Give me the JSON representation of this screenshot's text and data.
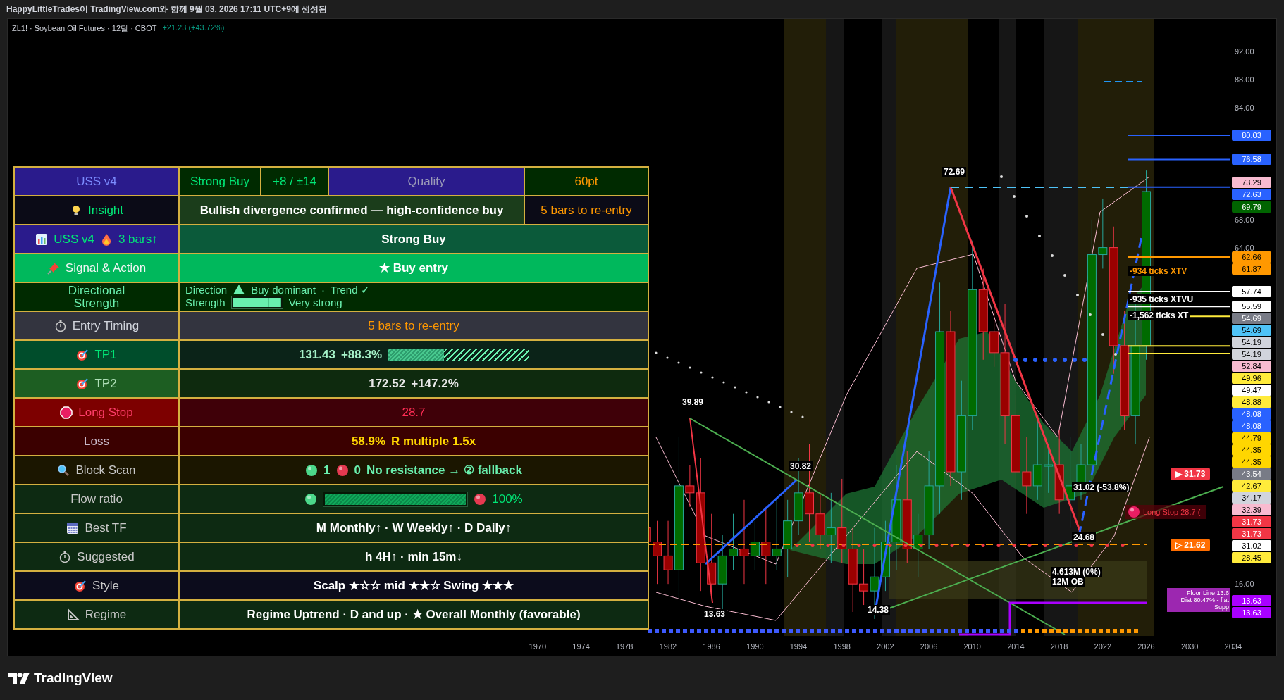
{
  "header": {
    "text": "HappyLittleTrades이 TradingView.com와 함께 9월 03, 2026 17:11 UTC+9에 생성됨"
  },
  "legend": {
    "symbol": "ZL1! · Soybean Oil Futures · 12달 · CBOT",
    "change": "+21.23 (+43.72%)"
  },
  "table": {
    "header": [
      "USS v4",
      "Strong Buy",
      "+8 / ±14",
      "Quality",
      "60pt"
    ],
    "rows": [
      {
        "kind": "insight",
        "label": "Insight",
        "message": "Bullish divergence confirmed — high-confidence buy",
        "note": "5 bars to re-entry"
      },
      {
        "kind": "streak",
        "label": "USS v4",
        "streak": "3 bars↑",
        "value": "Strong Buy"
      },
      {
        "kind": "plain",
        "label": "Signal & Action",
        "value": "★ Buy entry"
      },
      {
        "kind": "direction",
        "label": "Directional Strength",
        "direction_label": "Direction",
        "direction": "Buy dominant",
        "separator": "·",
        "trend": "Trend ✓",
        "strength_label": "Strength",
        "level": 1,
        "strength": "Very strong"
      },
      {
        "kind": "plain",
        "label": "Entry Timing",
        "value": "5 bars to re-entry"
      },
      {
        "kind": "target",
        "label": "TP1",
        "price": "131.43",
        "change": "+88.3%",
        "level": 0.4
      },
      {
        "kind": "target",
        "label": "TP2",
        "price": "172.52",
        "change": "+147.2%"
      },
      {
        "kind": "plain",
        "label": "Long Stop",
        "value": "28.7"
      },
      {
        "kind": "pair",
        "label": "Loss",
        "value": "58.9%",
        "extra": "R multiple 1.5x"
      },
      {
        "kind": "scan",
        "label": "Block Scan",
        "support": "1",
        "resistance": "0",
        "note": "No resistance → ② fallback"
      },
      {
        "kind": "flow",
        "label": "Flow ratio",
        "level": 1,
        "value": "100%"
      },
      {
        "kind": "plain",
        "label": "Best TF",
        "value": "M Monthly↑ · W Weekly↑ · D Daily↑"
      },
      {
        "kind": "plain",
        "label": "Suggested",
        "value": "h 4H↑ · min 15m↓"
      },
      {
        "kind": "plain",
        "label": "Style",
        "value": "Scalp ★☆☆ mid ★★☆ Swing ★★★"
      },
      {
        "kind": "plain",
        "label": "Regime",
        "value": "Regime Uptrend · D and up · ★ Overall Monthly (favorable)"
      }
    ]
  },
  "annotations": [
    {
      "text": "72.69"
    },
    {
      "text": "39.89"
    },
    {
      "text": "30.82"
    },
    {
      "text": "13.63"
    },
    {
      "text": "14.38"
    },
    {
      "text": "24.68"
    },
    {
      "text": "-935 ticks XTVU"
    },
    {
      "text": "-1,562 ticks XT"
    },
    {
      "text": "31.02 (-53.8%)"
    },
    {
      "text": "4.613M (0%)"
    },
    {
      "text": "12M OB"
    }
  ],
  "target_note": {
    "text": "-934 ticks XTV"
  },
  "callouts": [
    {
      "text": "▶ 31.73",
      "color": "#f23645"
    },
    {
      "text": "▷ 21.62",
      "color": "#ff6d00"
    }
  ],
  "long_stop": {
    "text": "Long Stop 28.7 (-"
  },
  "floor_label": [
    "Floor Line 13.6",
    "Dist 80.47% - flat",
    "Supp"
  ],
  "price_axis": {
    "ticks": [
      "92.00",
      "88.00",
      "84.00",
      "68.00",
      "64.00",
      "16.00"
    ],
    "tags": [
      {
        "text": "80.03",
        "color": "#2962ff"
      },
      {
        "text": "76.58",
        "color": "#2962ff"
      },
      {
        "text": "73.29",
        "color": "#f8bbd0"
      },
      {
        "text": "72.63",
        "color": "#2962ff"
      },
      {
        "text": "69.79",
        "color": "#006400"
      },
      {
        "text": "62.66",
        "color": "#ff9800"
      },
      {
        "text": "61.87",
        "color": "#ff9800"
      },
      {
        "text": "57.74",
        "color": "#ffffff"
      },
      {
        "text": "55.59",
        "color": "#ffffff"
      },
      {
        "text": "54.69",
        "color": "#787b86"
      },
      {
        "text": "54.69",
        "color": "#4fc3f7"
      },
      {
        "text": "54.19",
        "color": "#d1d4dc"
      },
      {
        "text": "54.19",
        "color": "#d1d4dc"
      },
      {
        "text": "52.84",
        "color": "#f8bbd0"
      },
      {
        "text": "49.96",
        "color": "#ffeb3b"
      },
      {
        "text": "49.47",
        "color": "#ffffff"
      },
      {
        "text": "48.88",
        "color": "#ffeb3b"
      },
      {
        "text": "48.08",
        "color": "#2962ff"
      },
      {
        "text": "48.08",
        "color": "#2962ff"
      },
      {
        "text": "44.79",
        "color": "#ffd600"
      },
      {
        "text": "44.35",
        "color": "#ffd600"
      },
      {
        "text": "44.35",
        "color": "#ffd600"
      },
      {
        "text": "43.54",
        "color": "#787b86"
      },
      {
        "text": "42.67",
        "color": "#ffeb3b"
      },
      {
        "text": "34.17",
        "color": "#d1d4dc"
      },
      {
        "text": "32.39",
        "color": "#f8bbd0"
      },
      {
        "text": "31.73",
        "color": "#f23645"
      },
      {
        "text": "31.73",
        "color": "#f23645"
      },
      {
        "text": "31.02",
        "color": "#ffffff"
      },
      {
        "text": "28.45",
        "color": "#ffeb3b"
      },
      {
        "text": "13.63",
        "color": "#aa00ff"
      },
      {
        "text": "13.63",
        "color": "#aa00ff"
      }
    ]
  },
  "time_axis": [
    "1970",
    "1974",
    "1978",
    "1982",
    "1986",
    "1990",
    "1994",
    "1998",
    "2002",
    "2006",
    "2010",
    "2014",
    "2018",
    "2022",
    "2026",
    "2030",
    "2034"
  ],
  "footer": {
    "brand": "TradingView"
  }
}
